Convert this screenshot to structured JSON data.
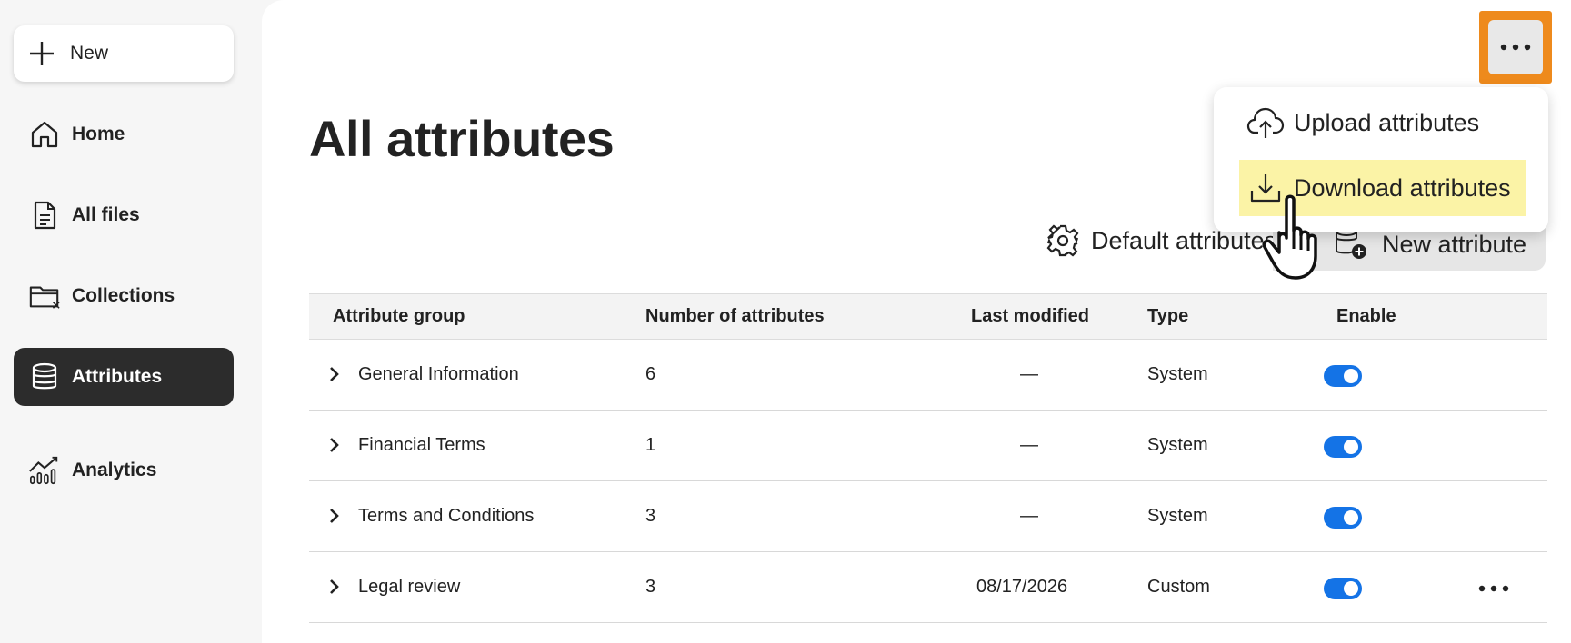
{
  "sidebar": {
    "new_label": "New",
    "items": [
      {
        "label": "Home",
        "icon": "home-icon"
      },
      {
        "label": "All files",
        "icon": "file-icon"
      },
      {
        "label": "Collections",
        "icon": "folder-icon"
      },
      {
        "label": "Attributes",
        "icon": "database-icon",
        "active": true
      },
      {
        "label": "Analytics",
        "icon": "analytics-icon"
      }
    ]
  },
  "main": {
    "title": "All attributes",
    "default_attributes_label": "Default attributes",
    "new_attribute_label": "New attribute"
  },
  "menu": {
    "items": [
      {
        "label": "Upload attributes",
        "icon": "cloud-upload-icon"
      },
      {
        "label": "Download attributes",
        "icon": "download-icon",
        "highlighted": true
      }
    ]
  },
  "table": {
    "columns": [
      "Attribute group",
      "Number of attributes",
      "Last modified",
      "Type",
      "Enable"
    ],
    "rows": [
      {
        "group": "General Information",
        "count": "6",
        "modified": "—",
        "type": "System",
        "enabled": true
      },
      {
        "group": "Financial Terms",
        "count": "1",
        "modified": "—",
        "type": "System",
        "enabled": true
      },
      {
        "group": "Terms and Conditions",
        "count": "3",
        "modified": "—",
        "type": "System",
        "enabled": true
      },
      {
        "group": "Legal review",
        "count": "3",
        "modified": "08/17/2026",
        "type": "Custom",
        "enabled": true,
        "has_more": true
      }
    ]
  },
  "colors": {
    "accent": "#1473e6",
    "highlight_orange": "#ee8a1c",
    "menu_highlight": "#fbf3a6",
    "active_nav": "#2c2c2c"
  }
}
